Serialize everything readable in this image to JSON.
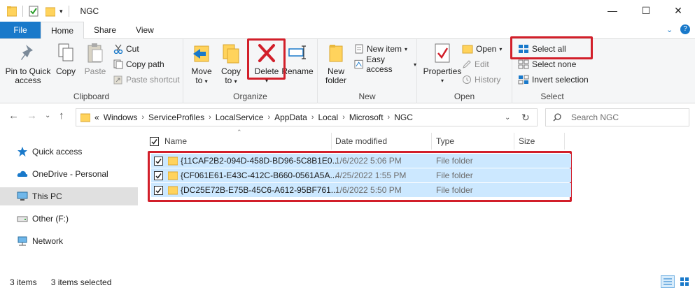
{
  "window": {
    "title": "NGC",
    "controls": [
      "—",
      "☐",
      "✕"
    ]
  },
  "tabs": [
    {
      "label": "File"
    },
    {
      "label": "Home"
    },
    {
      "label": "Share"
    },
    {
      "label": "View"
    }
  ],
  "ribbon": {
    "clipboard": {
      "label": "Clipboard",
      "pin_label_1": "Pin to Quick",
      "pin_label_2": "access",
      "copy": "Copy",
      "paste": "Paste",
      "cut": "Cut",
      "copy_path": "Copy path",
      "paste_shortcut": "Paste shortcut"
    },
    "organize": {
      "label": "Organize",
      "move_1": "Move",
      "move_2": "to",
      "copy_1": "Copy",
      "copy_2": "to",
      "delete": "Delete",
      "rename": "Rename"
    },
    "new": {
      "label": "New",
      "new_folder_1": "New",
      "new_folder_2": "folder",
      "new_item": "New item",
      "easy_access": "Easy access"
    },
    "open": {
      "label": "Open",
      "properties": "Properties",
      "open": "Open",
      "edit": "Edit",
      "history": "History"
    },
    "select": {
      "label": "Select",
      "select_all": "Select all",
      "select_none": "Select none",
      "invert_selection": "Invert selection"
    }
  },
  "address": {
    "overflow": "«",
    "crumbs": [
      "Windows",
      "ServiceProfiles",
      "LocalService",
      "AppData",
      "Local",
      "Microsoft",
      "NGC"
    ],
    "search_placeholder": "Search NGC"
  },
  "navpane": [
    {
      "label": "Quick access"
    },
    {
      "label": "OneDrive - Personal"
    },
    {
      "label": "This PC"
    },
    {
      "label": "Other (F:)"
    },
    {
      "label": "Network"
    }
  ],
  "columns": {
    "name": "Name",
    "date": "Date modified",
    "type": "Type",
    "size": "Size"
  },
  "files": [
    {
      "name": "{11CAF2B2-094D-458D-BD96-5C8B1E0...",
      "date": "1/6/2022 5:06 PM",
      "type": "File folder"
    },
    {
      "name": "{CF061E61-E43C-412C-B660-0561A5A...",
      "date": "4/25/2022 1:55 PM",
      "type": "File folder"
    },
    {
      "name": "{DC25E72B-E75B-45C6-A612-95BF761...",
      "date": "1/6/2022 5:50 PM",
      "type": "File folder"
    }
  ],
  "status": {
    "items": "3 items",
    "selected": "3 items selected"
  },
  "colors": {
    "file_tab": "#1979ca",
    "selection": "#cce8ff",
    "highlight_box": "#d21f2a",
    "folder": "#ffd35c"
  }
}
